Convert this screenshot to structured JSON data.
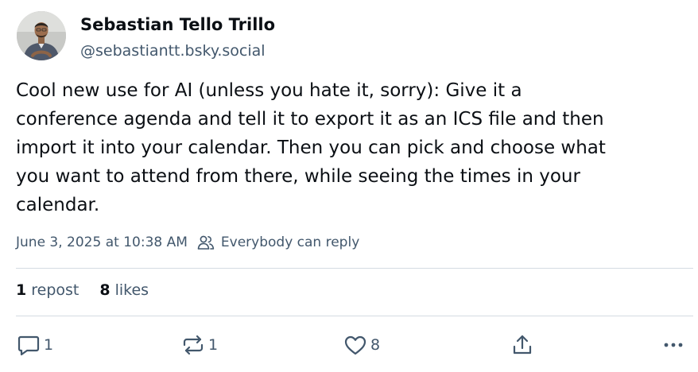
{
  "author": {
    "display_name": "Sebastian Tello Trillo",
    "handle": "@sebastiantt.bsky.social"
  },
  "post": {
    "text": "Cool new use for AI (unless you hate it, sorry): Give it a\nconference agenda and tell it to export it as an ICS file and then\nimport it into your calendar. Then you can pick and choose what\nyou want to attend from there, while seeing the times in your\ncalendar.",
    "timestamp": "June 3, 2025 at 10:38 AM",
    "reply_setting": "Everybody can reply",
    "reply_setting_icon": "people-icon"
  },
  "stats": {
    "reposts": {
      "count": "1",
      "label": "repost"
    },
    "likes": {
      "count": "8",
      "label": "likes"
    }
  },
  "actions": {
    "reply": {
      "icon": "reply-icon",
      "count": "1"
    },
    "repost": {
      "icon": "repost-icon",
      "count": "1"
    },
    "like": {
      "icon": "heart-icon",
      "count": "8"
    },
    "share": {
      "icon": "share-icon"
    },
    "more": {
      "icon": "more-icon"
    }
  },
  "colors": {
    "text": "#0b0f14",
    "secondary_text": "#42576c",
    "divider": "#d4dbe2",
    "background": "#ffffff"
  }
}
